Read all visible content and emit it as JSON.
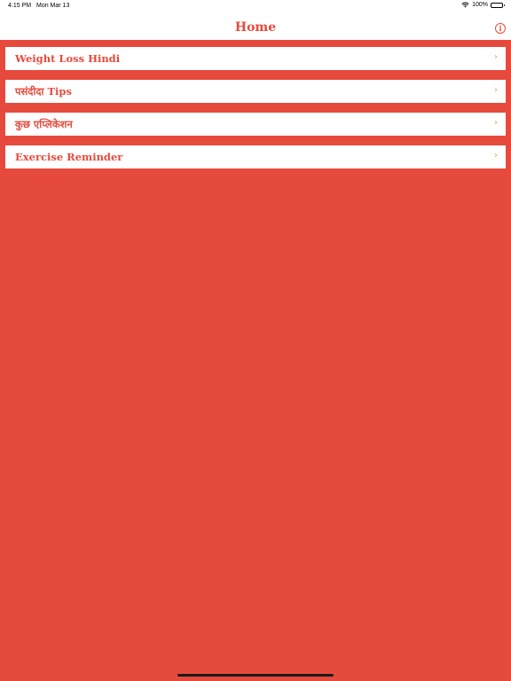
{
  "status_bar": {
    "time": "4:15 PM",
    "date": "Mon Mar 13",
    "battery": "100%"
  },
  "nav": {
    "title": "Home",
    "info_label": "i"
  },
  "items": [
    {
      "label": "Weight Loss Hindi"
    },
    {
      "label": "पसंदीदा Tips"
    },
    {
      "label": "कुछ एप्लिकेशन"
    },
    {
      "label": "Exercise Reminder"
    }
  ],
  "chevron": "›",
  "colors": {
    "brand": "#E64A3C",
    "chevron": "#F0A030",
    "surface": "#FFFFFF"
  },
  "icons": {
    "wifi": "wifi-icon",
    "battery": "battery-icon",
    "info": "info-icon",
    "chevron": "chevron-right-icon"
  }
}
